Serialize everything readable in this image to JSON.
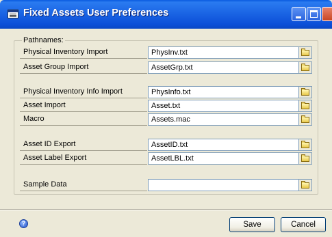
{
  "window": {
    "title": "Fixed Assets User Preferences"
  },
  "group": {
    "label": "Pathnames:"
  },
  "rows": [
    {
      "label": "Physical Inventory Import",
      "value": "PhysInv.txt"
    },
    {
      "label": "Asset Group Import",
      "value": "AssetGrp.txt"
    },
    {
      "label": "Physical Inventory Info Import",
      "value": "PhysInfo.txt"
    },
    {
      "label": "Asset Import",
      "value": "Asset.txt"
    },
    {
      "label": "Macro",
      "value": "Assets.mac"
    },
    {
      "label": "Asset ID Export",
      "value": "AssetID.txt"
    },
    {
      "label": "Asset Label Export",
      "value": "AssetLBL.txt"
    },
    {
      "label": "Sample Data",
      "value": ""
    }
  ],
  "footer": {
    "help_glyph": "?",
    "save_label": "Save",
    "cancel_label": "Cancel"
  },
  "colors": {
    "titlebar": "#0a5be0",
    "dialog_bg": "#ece9d8",
    "field_border": "#7f9db9"
  }
}
